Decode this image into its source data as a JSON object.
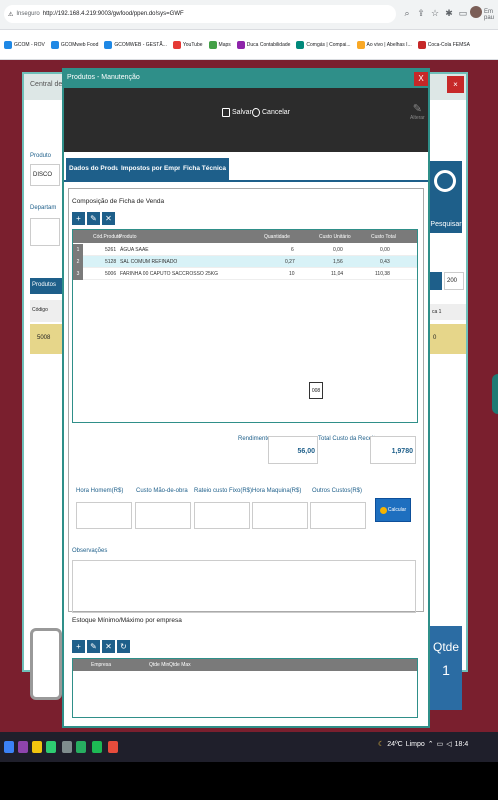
{
  "browser": {
    "security_label": "Inseguro",
    "url": "http://192.168.4.219:9003/gwfood/ppen.do!sys=GWF",
    "side_label": "Em pau"
  },
  "bookmarks": [
    {
      "label": "GCOM - ROV",
      "color": "#1e88e5"
    },
    {
      "label": "GCOMweb Food",
      "color": "#1e88e5"
    },
    {
      "label": "GCOMWEB - GESTÃ...",
      "color": "#1e88e5"
    },
    {
      "label": "YouTube",
      "color": "#e53935"
    },
    {
      "label": "Maps",
      "color": "#43a047"
    },
    {
      "label": "Duca Contabilidade",
      "color": "#8e24aa"
    },
    {
      "label": "Comgás | Compai...",
      "color": "#00897b"
    },
    {
      "label": "Ao vivo | Abelhas I...",
      "color": "#f9a825"
    },
    {
      "label": "Coca-Cola FEMSA",
      "color": "#c62828"
    }
  ],
  "background": {
    "title": "Central de P",
    "produto_label": "Produto",
    "produto_value": "DISCO",
    "departamento_label": "Departam",
    "produtos_label": "Produtos",
    "codigo_header": "Código",
    "codigo_value": "5008",
    "pesquisar_label": "Pesquisar",
    "page_size": "200",
    "col_right": "ca 1",
    "right_value": "0",
    "qtde_label": "Qtde",
    "qtde_value": "1"
  },
  "modal": {
    "title": "Produtos - Manutenção",
    "close": "X",
    "save_label": "Salvar",
    "cancel_label": "Cancelar",
    "alter_label": "Alterar",
    "tabs": [
      "Dados do Produto",
      "Impostos por Empresa",
      "Ficha Técnica"
    ],
    "composition_title": "Composição de Ficha de Venda",
    "grid_headers": [
      "Cód.Produto",
      "Produto",
      "Quantidade",
      "Custo Unitário",
      "Custo Total"
    ],
    "grid_rows": [
      {
        "n": "1",
        "code": "5261",
        "name": "ÁGUA SAAE",
        "qty": "6",
        "unit": "0,00",
        "total": "0,00"
      },
      {
        "n": "2",
        "code": "5128",
        "name": "SAL COMUM REFINADO",
        "qty": "0,27",
        "unit": "1,56",
        "total": "0,43"
      },
      {
        "n": "3",
        "code": "5006",
        "name": "FARINHA 00 CAPUTO SACCROSSO 25KG",
        "qty": "10",
        "unit": "11,04",
        "total": "110,38"
      }
    ],
    "page_indicator": "008",
    "rendimento_label": "Rendimento",
    "rendimento_value": "56,00",
    "custo_receita_label": "Total Custo da Receita",
    "custo_receita_value": "1,9780",
    "cost_labels": [
      "Hora Homem(R$)",
      "Custo Mão-de-obra",
      "Rateio custo Fixo(R$)",
      "Hora Maquina(R$)",
      "Outros Custos(R$)"
    ],
    "calc_label": "Calcular",
    "observacoes_label": "Observações",
    "estoque_title": "Estoque Mínimo/Máximo por empresa",
    "estoque_headers": [
      "Empresa",
      "Qtde Min",
      "Qtde Max"
    ]
  },
  "taskbar": {
    "temp": "24ºC",
    "weather": "Limpo",
    "time": "18:4"
  }
}
